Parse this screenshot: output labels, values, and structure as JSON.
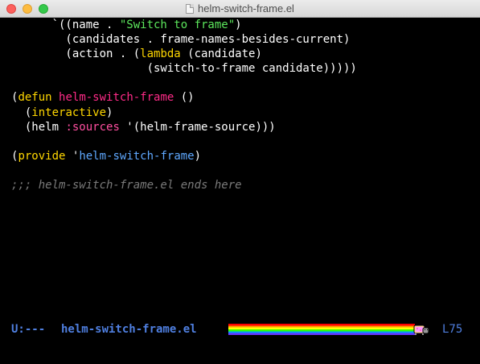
{
  "window": {
    "title": "helm-switch-frame.el"
  },
  "editor": {
    "lines": [
      "      `((name . \"Switch to frame\")",
      "        (candidates . frame-names-besides-current)",
      "        (action . (lambda (candidate)",
      "                    (switch-to-frame candidate)))))",
      "",
      "(defun helm-switch-frame ()",
      "  (interactive)",
      "  (helm :sources '(helm-frame-source)))",
      "",
      "(provide 'helm-switch-frame)",
      "",
      ";;; helm-switch-frame.el ends here"
    ]
  },
  "modeline": {
    "status": "U:---",
    "buffer_name": "helm-switch-frame.el",
    "line": "L75"
  },
  "colors": {
    "background": "#000000",
    "keyword": "#ffd700",
    "function_name": "#ff2b88",
    "string": "#5ce65c",
    "constant": "#5fa8ff",
    "comment": "#7a7a7a",
    "modeline": "#4f7fe0"
  }
}
